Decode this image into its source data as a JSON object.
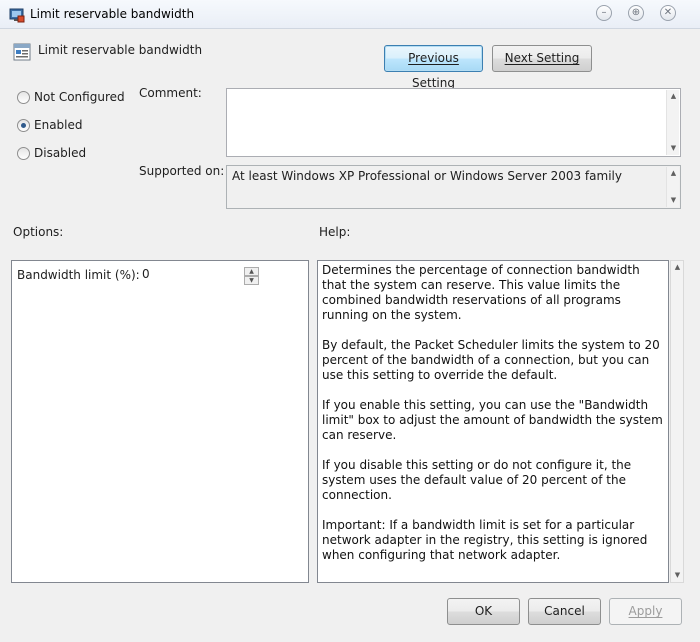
{
  "window": {
    "title": "Limit reservable bandwidth",
    "minimize_glyph": "–",
    "maximize_glyph": "⊕",
    "close_glyph": "✕"
  },
  "header": {
    "title": "Limit reservable bandwidth",
    "icon": "policy-setting-icon"
  },
  "nav": {
    "previous_label": "Previous Setting",
    "next_label": "Next Setting"
  },
  "state": {
    "options": [
      {
        "label": "Not Configured",
        "checked": false
      },
      {
        "label": "Enabled",
        "checked": true
      },
      {
        "label": "Disabled",
        "checked": false
      }
    ]
  },
  "comment": {
    "label": "Comment:",
    "value": ""
  },
  "supported": {
    "label": "Supported on:",
    "value": "At least Windows XP Professional or Windows Server 2003 family"
  },
  "options_section": {
    "label": "Options:",
    "bandwidth_label": "Bandwidth limit (%):",
    "bandwidth_value": "0"
  },
  "help_section": {
    "label": "Help:",
    "paragraphs": [
      "Determines the percentage of connection bandwidth that the system can reserve. This value limits the combined bandwidth reservations of all programs running on the system.",
      "By default, the Packet Scheduler limits the system to 20 percent of the bandwidth of a connection, but you can use this setting to override the default.",
      "If you enable this setting, you can use the \"Bandwidth limit\" box to adjust the amount of bandwidth the system can reserve.",
      "If you disable this setting or do not configure it, the system uses the default value of 20 percent of the connection.",
      "Important: If a bandwidth limit is set for a particular network adapter in the registry, this setting is ignored when configuring that network adapter."
    ]
  },
  "footer": {
    "ok_label": "OK",
    "cancel_label": "Cancel",
    "apply_label": "Apply"
  },
  "arrows": {
    "up": "▲",
    "down": "▼"
  }
}
